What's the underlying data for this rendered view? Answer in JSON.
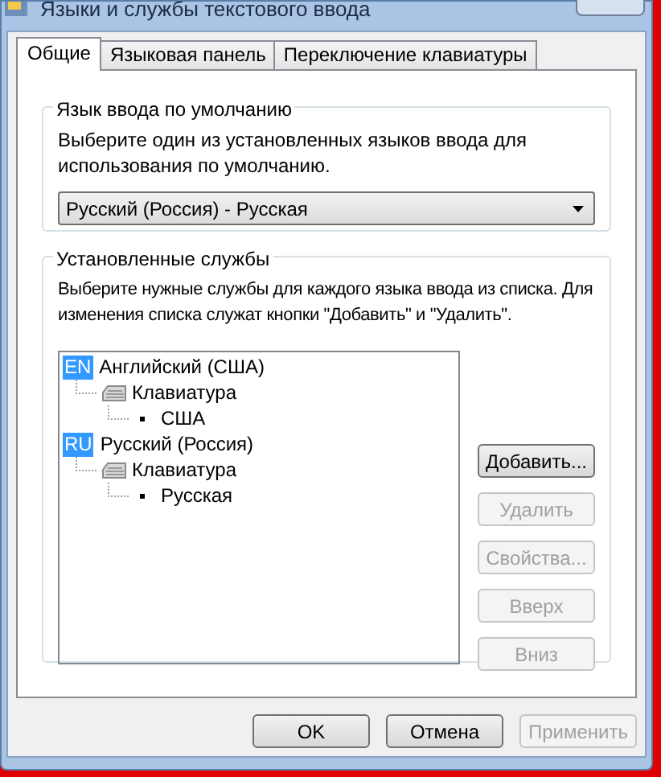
{
  "window": {
    "title": "Языки и службы текстового ввода"
  },
  "tabs": [
    {
      "label": "Общие",
      "selected": true
    },
    {
      "label": "Языковая панель",
      "selected": false
    },
    {
      "label": "Переключение клавиатуры",
      "selected": false
    }
  ],
  "default_language": {
    "title": "Язык ввода по умолчанию",
    "description": "Выберите один из установленных языков ввода для использования по умолчанию.",
    "dropdown": {
      "value": "Русский (Россия) - Русская"
    }
  },
  "installed_services": {
    "title": "Установленные службы",
    "description": "Выберите нужные службы для каждого языка ввода из списка. Для изменения списка служат кнопки \"Добавить\" и \"Удалить\".",
    "tree": [
      {
        "kind": "language",
        "badge": "EN",
        "label": "Английский (США)",
        "children": [
          {
            "kind": "category",
            "label": "Клавиатура",
            "children": [
              {
                "kind": "layout",
                "label": "США"
              }
            ]
          }
        ]
      },
      {
        "kind": "language",
        "badge": "RU",
        "label": "Русский (Россия)",
        "children": [
          {
            "kind": "category",
            "label": "Клавиатура",
            "children": [
              {
                "kind": "layout",
                "label": "Русская"
              }
            ]
          }
        ]
      }
    ],
    "buttons": [
      {
        "label": "Добавить...",
        "disabled": false
      },
      {
        "label": "Удалить",
        "disabled": true
      },
      {
        "label": "Свойства...",
        "disabled": true
      },
      {
        "label": "Вверх",
        "disabled": true
      },
      {
        "label": "Вниз",
        "disabled": true
      }
    ]
  },
  "footer_buttons": [
    {
      "label": "OK",
      "disabled": false
    },
    {
      "label": "Отмена",
      "disabled": false
    },
    {
      "label": "Применить",
      "disabled": true
    }
  ]
}
